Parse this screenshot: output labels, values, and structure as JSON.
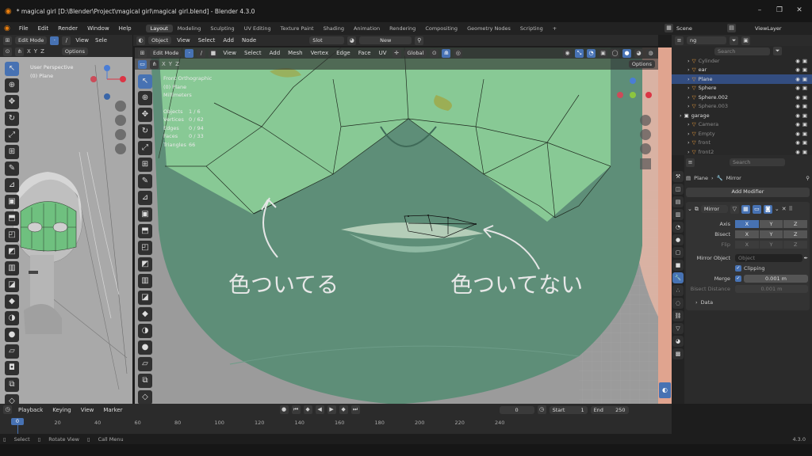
{
  "window": {
    "title": "* magical girl [D:\\Blender\\Project\\magical girl\\magical girl.blend] - Blender 4.3.0",
    "minimize": "–",
    "maximize": "❐",
    "close": "✕"
  },
  "menu": {
    "items": [
      "File",
      "Edit",
      "Render",
      "Window",
      "Help"
    ]
  },
  "workspaces": [
    "Layout",
    "Modeling",
    "Sculpting",
    "UV Editing",
    "Texture Paint",
    "Shading",
    "Animation",
    "Rendering",
    "Compositing",
    "Geometry Nodes",
    "Scripting"
  ],
  "add_workspace": "+",
  "scene": {
    "label": "Scene",
    "viewlayer": "ViewLayer"
  },
  "left_view": {
    "mode": "Edit Mode",
    "view": "View",
    "select": "Sele",
    "options": "Options",
    "x": "X",
    "y": "Y",
    "z": "Z",
    "info1": "User Perspective",
    "info2": "(0) Plane"
  },
  "node_header": {
    "object": "Object",
    "view": "View",
    "select": "Select",
    "add": "Add",
    "node": "Node",
    "slot": "Slot",
    "new": "New"
  },
  "viewport": {
    "mode": "Edit Mode",
    "menus": [
      "View",
      "Select",
      "Add",
      "Mesh",
      "Vertex",
      "Edge",
      "Face",
      "UV"
    ],
    "orientation": "Global",
    "options": "Options",
    "x": "X",
    "y": "Y",
    "z": "Z",
    "info_title": "Front Orthographic",
    "info_obj": "(0) Plane",
    "info_units": "Millimeters",
    "stats": [
      {
        "k": "Objects",
        "v": "1 / 6"
      },
      {
        "k": "Vertices",
        "v": "0 / 62"
      },
      {
        "k": "Edges",
        "v": "0 / 94"
      },
      {
        "k": "Faces",
        "v": "0 / 33"
      },
      {
        "k": "Triangles",
        "v": "66"
      }
    ],
    "annotation_left": "色ついてる",
    "annotation_right": "色ついてない"
  },
  "outliner": {
    "search": "Search",
    "filter": "ng",
    "items": [
      {
        "name": "Cylinder",
        "indent": 2,
        "sel": false,
        "dim": true
      },
      {
        "name": "ear",
        "indent": 2,
        "sel": false,
        "dim": false
      },
      {
        "name": "Plane",
        "indent": 2,
        "sel": true,
        "dim": false
      },
      {
        "name": "Sphere",
        "indent": 2,
        "sel": false,
        "dim": false
      },
      {
        "name": "Sphere.002",
        "indent": 2,
        "sel": false,
        "dim": false
      },
      {
        "name": "Sphere.003",
        "indent": 2,
        "sel": false,
        "dim": true
      },
      {
        "name": "garage",
        "indent": 1,
        "sel": false,
        "dim": false
      },
      {
        "name": "Camera",
        "indent": 2,
        "sel": false,
        "dim": true
      },
      {
        "name": "Empty",
        "indent": 2,
        "sel": false,
        "dim": true
      },
      {
        "name": "front",
        "indent": 2,
        "sel": false,
        "dim": true
      },
      {
        "name": "front2",
        "indent": 2,
        "sel": false,
        "dim": true
      }
    ]
  },
  "properties": {
    "search": "Search",
    "object": "Plane",
    "modifier_crumb": "Mirror",
    "add_modifier": "Add Modifier",
    "modifier_name": "Mirror",
    "axis_label": "Axis",
    "bisect_label": "Bisect",
    "flip_label": "Flip",
    "axes": [
      "X",
      "Y",
      "Z"
    ],
    "mirror_object_label": "Mirror Object",
    "mirror_object_placeholder": "Object",
    "clipping": "Clipping",
    "merge_label": "Merge",
    "merge_value": "0.001 m",
    "bisect_distance_label": "Bisect Distance",
    "bisect_distance_value": "0.001 m",
    "data": "Data"
  },
  "timeline": {
    "playback": "Playback",
    "keying": "Keying",
    "view": "View",
    "marker": "Marker",
    "current": "0",
    "start_label": "Start",
    "start": "1",
    "end_label": "End",
    "end": "250",
    "ticks": [
      "0",
      "20",
      "40",
      "60",
      "80",
      "100",
      "120",
      "140",
      "160",
      "180",
      "200",
      "220",
      "240"
    ]
  },
  "status": {
    "select": "Select",
    "rotate": "Rotate View",
    "call_menu": "Call Menu",
    "version": "4.3.0"
  },
  "colors": {
    "accent": "#4772b3",
    "mesh_face": "#8fd49a",
    "skin": "#5e8e78"
  }
}
